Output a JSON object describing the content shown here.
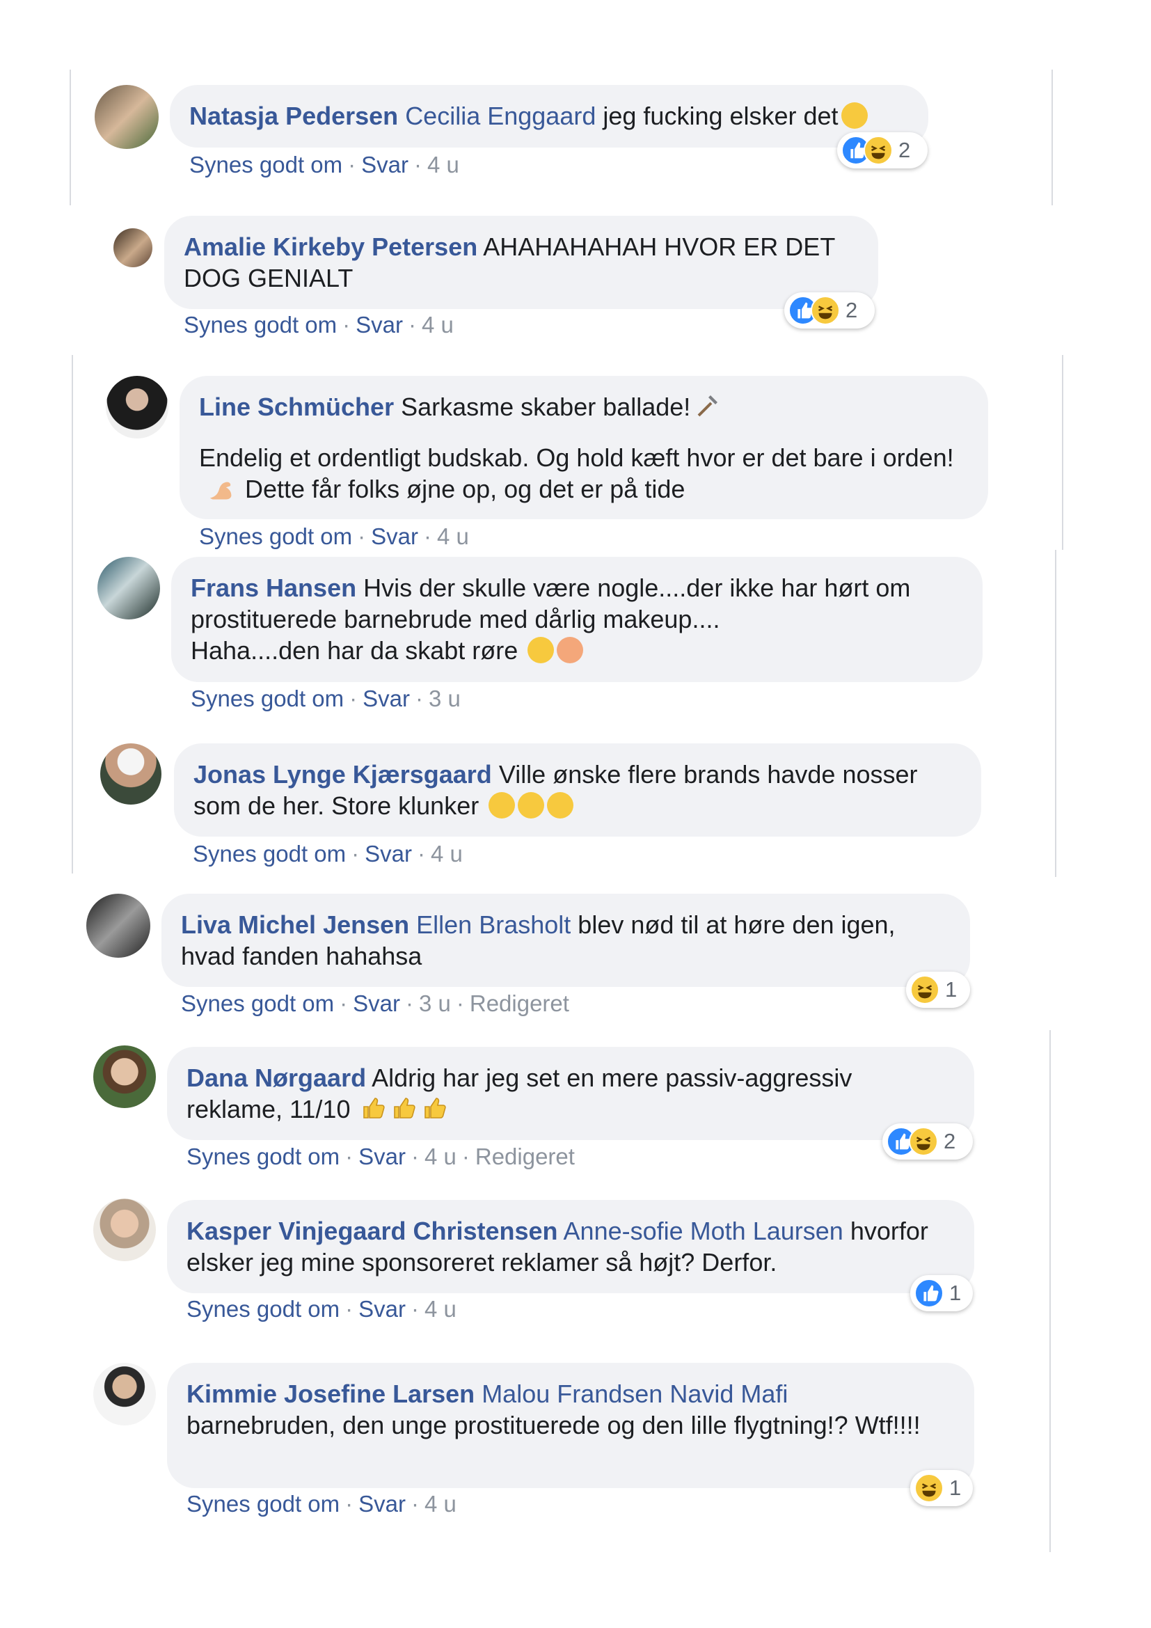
{
  "actions": {
    "like": "Synes godt om",
    "reply": "Svar",
    "sep": "·",
    "edited": "Redigeret"
  },
  "comments": [
    {
      "author": "Natasja Pedersen",
      "tags": "Cecilia Enggaard",
      "text": "jeg fucking elsker det",
      "time": "4 u",
      "reaction_count": "2",
      "reactions": [
        "like",
        "haha"
      ]
    },
    {
      "author": "Amalie Kirkeby Petersen",
      "tags": "",
      "text": "AHAHAHAHAH HVOR ER DET DOG GENIALT",
      "time": "4 u",
      "reaction_count": "2",
      "reactions": [
        "like",
        "haha"
      ]
    },
    {
      "author": "Line Schmücher",
      "tags": "",
      "text": "Sarkasme skaber ballade!",
      "text2": "Endelig et ordentligt budskab. Og hold kæft hvor er det bare i orden!",
      "text3": "Dette får folks øjne op, og det er på tide",
      "time": "4 u"
    },
    {
      "author": "Frans Hansen",
      "tags": "",
      "text": "Hvis der skulle være nogle....der ikke har hørt om prostituerede barnebrude med dårlig makeup....",
      "text2": "Haha....den har da skabt røre",
      "time": "3 u"
    },
    {
      "author": "Jonas Lynge Kjærsgaard",
      "tags": "",
      "text": "Ville ønske flere brands havde nosser som de her. Store klunker",
      "time": "4 u"
    },
    {
      "author": "Liva Michel Jensen",
      "tags": "Ellen Brasholt",
      "text": "blev nød til at høre den igen, hvad fanden hahahsa",
      "time": "3 u",
      "edited": true,
      "reaction_count": "1",
      "reactions": [
        "haha"
      ]
    },
    {
      "author": "Dana Nørgaard",
      "tags": "",
      "text": "Aldrig har jeg set en mere passiv-aggressiv reklame, 11/10",
      "time": "4 u",
      "edited": true,
      "reaction_count": "2",
      "reactions": [
        "like",
        "haha"
      ]
    },
    {
      "author": "Kasper Vinjegaard Christensen",
      "tags": "Anne-sofie Moth Laursen",
      "text": "hvorfor elsker jeg mine sponsoreret reklamer så højt? Derfor.",
      "time": "4 u",
      "reaction_count": "1",
      "reactions": [
        "like"
      ]
    },
    {
      "author": "Kimmie Josefine Larsen",
      "tags": "Malou Frandsen Navid Mafi",
      "text": "barnebruden, den unge prostituerede og den lille flygtning!? Wtf!!!!",
      "time": "4 u",
      "reaction_count": "1",
      "reactions": [
        "haha"
      ]
    }
  ]
}
